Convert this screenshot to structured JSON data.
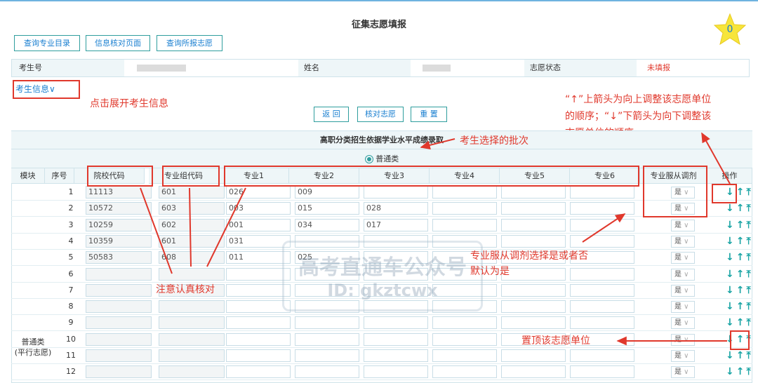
{
  "title": "征集志愿填报",
  "star_count": "0",
  "toolbar": {
    "btn1": "查询专业目录",
    "btn2": "信息核对页面",
    "btn3": "查询所报志愿"
  },
  "info": {
    "label1": "考生号",
    "label2": "姓名",
    "label3": "志愿状态",
    "status": "未填报"
  },
  "examinee_toggle": "考生信息",
  "actions": {
    "back": "返 回",
    "check": "核对志愿",
    "reset": "重 置"
  },
  "table": {
    "section_title": "高职分类招生依据学业水平成绩录取",
    "radio_label": "普通类",
    "headers": [
      "模块",
      "序号",
      "院校代码",
      "专业组代码",
      "专业1",
      "专业2",
      "专业3",
      "专业4",
      "专业5",
      "专业6",
      "专业服从调剂",
      "操作"
    ],
    "module_name": "普通类\n(平行志愿)",
    "rows": [
      {
        "idx": "1",
        "school": "11113",
        "group": "601",
        "m1": "026",
        "m2": "009",
        "m3": "",
        "adjust": "是"
      },
      {
        "idx": "2",
        "school": "10572",
        "group": "603",
        "m1": "003",
        "m2": "015",
        "m3": "028",
        "adjust": "是"
      },
      {
        "idx": "3",
        "school": "10259",
        "group": "602",
        "m1": "001",
        "m2": "034",
        "m3": "017",
        "adjust": "是"
      },
      {
        "idx": "4",
        "school": "10359",
        "group": "601",
        "m1": "031",
        "m2": "",
        "m3": "",
        "adjust": "是"
      },
      {
        "idx": "5",
        "school": "50583",
        "group": "608",
        "m1": "011",
        "m2": "025",
        "m3": "",
        "adjust": "是"
      },
      {
        "idx": "6",
        "school": "",
        "group": "",
        "m1": "",
        "m2": "",
        "m3": "",
        "adjust": "是"
      },
      {
        "idx": "7",
        "school": "",
        "group": "",
        "m1": "",
        "m2": "",
        "m3": "",
        "adjust": "是"
      },
      {
        "idx": "8",
        "school": "",
        "group": "",
        "m1": "",
        "m2": "",
        "m3": "",
        "adjust": "是"
      },
      {
        "idx": "9",
        "school": "",
        "group": "",
        "m1": "",
        "m2": "",
        "m3": "",
        "adjust": "是"
      },
      {
        "idx": "10",
        "school": "",
        "group": "",
        "m1": "",
        "m2": "",
        "m3": "",
        "adjust": "是"
      },
      {
        "idx": "11",
        "school": "",
        "group": "",
        "m1": "",
        "m2": "",
        "m3": "",
        "adjust": "是"
      },
      {
        "idx": "12",
        "school": "",
        "group": "",
        "m1": "",
        "m2": "",
        "m3": "",
        "adjust": "是"
      }
    ]
  },
  "annotations": {
    "expand": "点击展开考生信息",
    "batch": "考生选择的批次",
    "arrows_l1": "“↑”上箭头为向上调整该志愿单位",
    "arrows_l2": "的顺序；“↓”下箭头为向下调整该",
    "arrows_l3": "志愿单位的顺序",
    "check": "注意认真核对",
    "adjust_l1": "专业服从调剂选择是或者否",
    "adjust_l2": "默认为是",
    "top": "置顶该志愿单位"
  },
  "watermark": {
    "line1": "高考直通车公众号",
    "line2": "ID: gkztcwx"
  },
  "colors": {
    "accent": "#1a7fd0",
    "teal": "#2f9e9e",
    "annotation_red": "#e0382c",
    "header_bg": "#eef6f8"
  }
}
